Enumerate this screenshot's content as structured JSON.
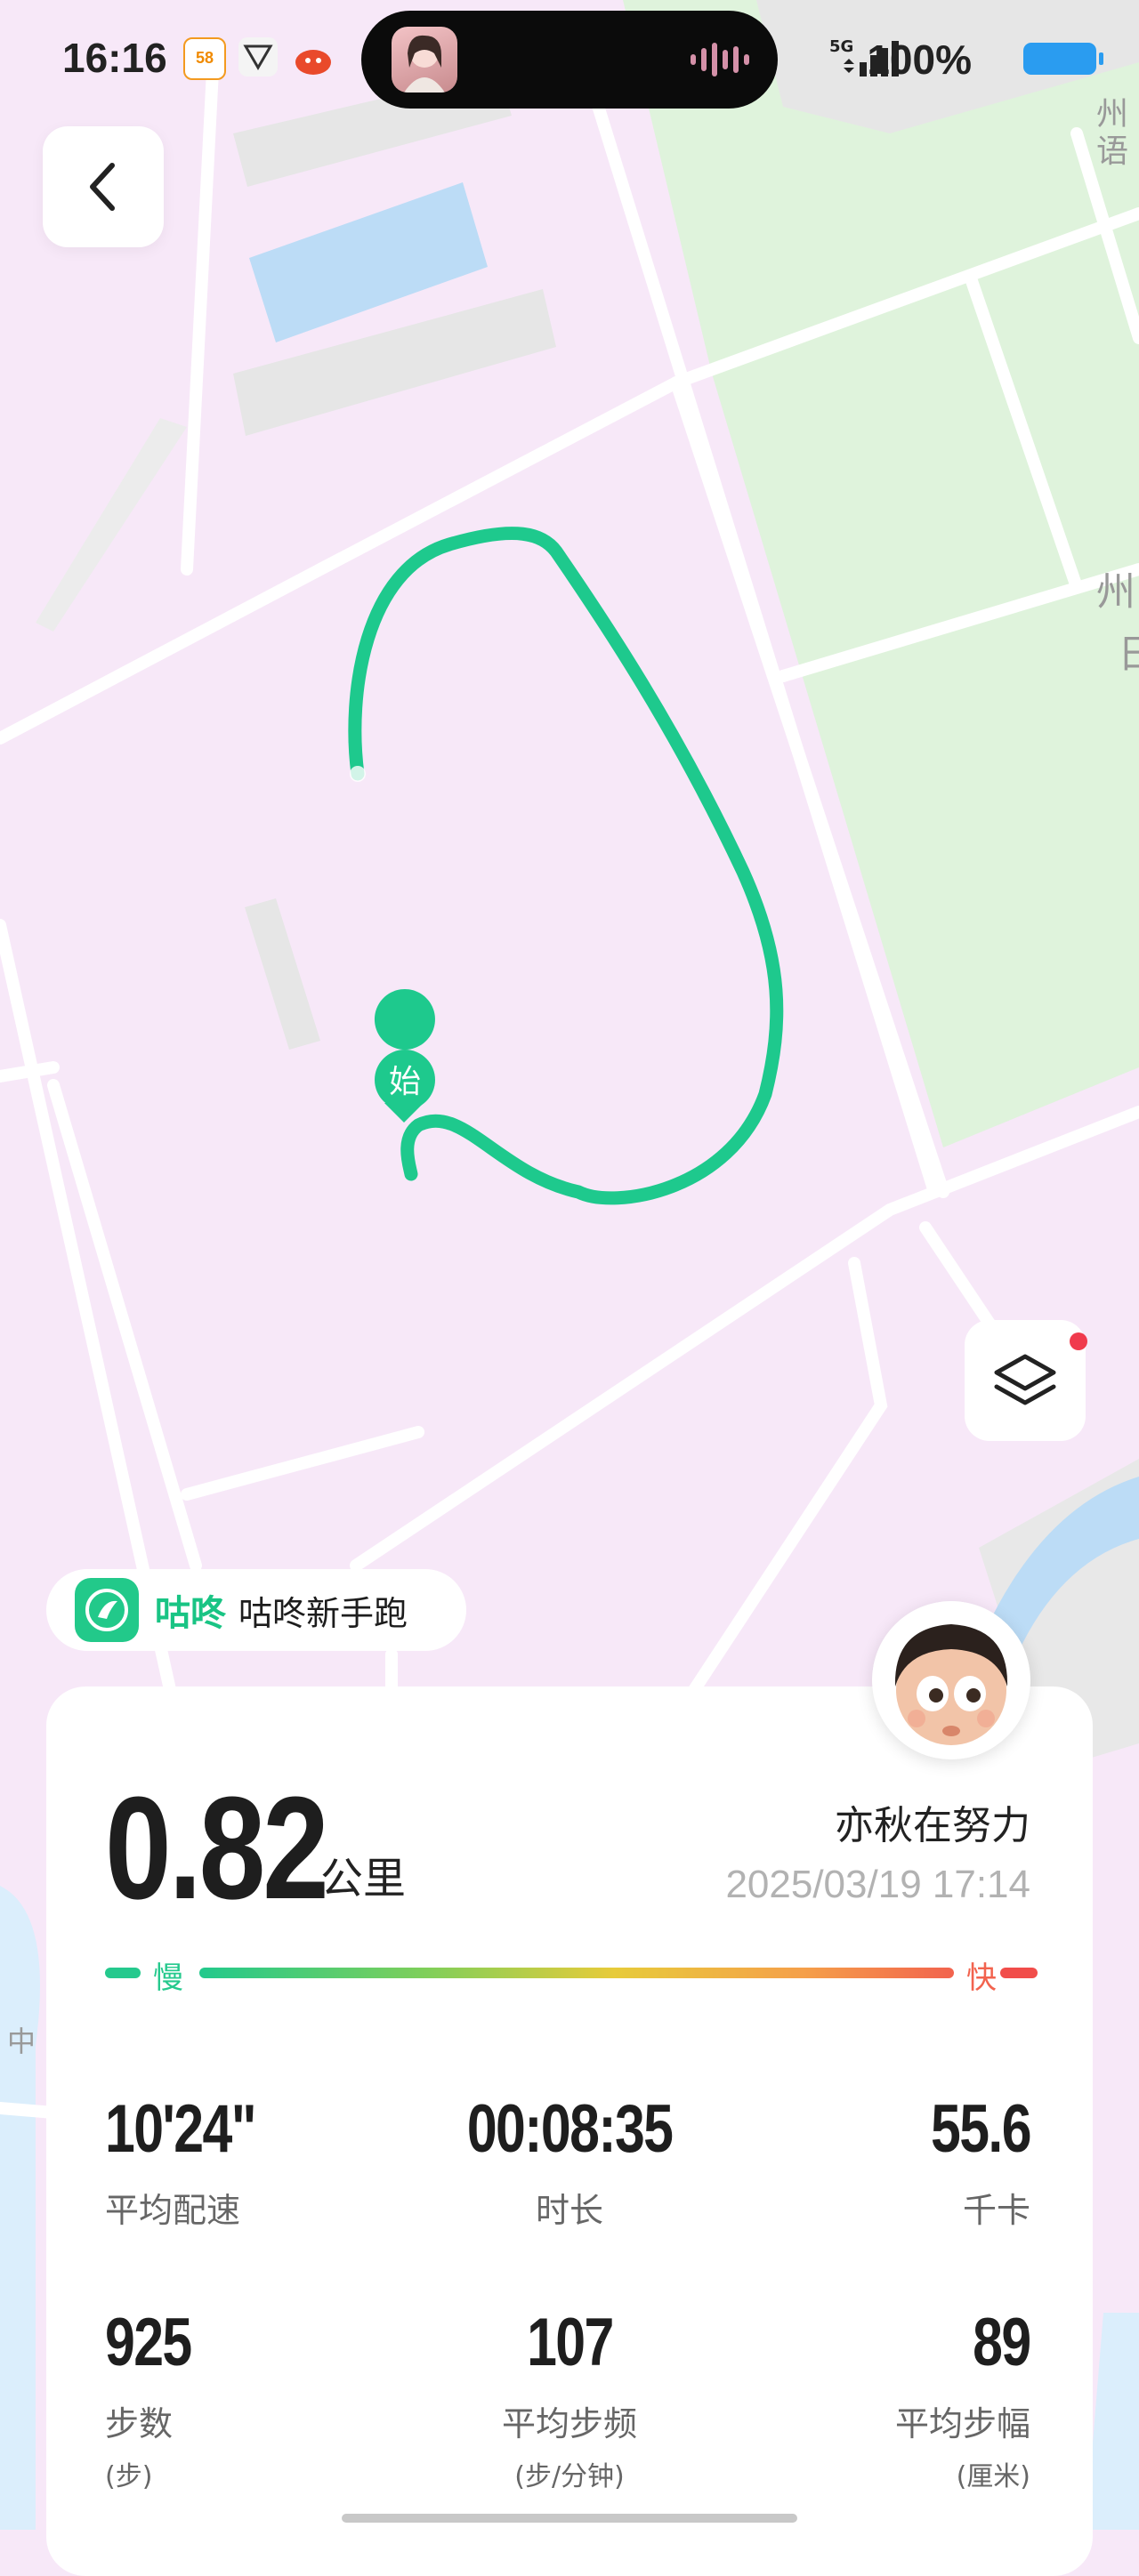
{
  "status_bar": {
    "time": "16:16",
    "network": "5G",
    "battery_percent": "100%",
    "notification_icons": [
      "58-app-icon",
      "game-app-icon",
      "red-app-icon"
    ]
  },
  "map": {
    "start_marker": "始",
    "map_labels": [
      "州",
      "语",
      "州",
      "日",
      "中"
    ]
  },
  "brand": {
    "logo_name": "咕咚",
    "tagline": "咕咚新手跑"
  },
  "summary": {
    "distance": "0.82",
    "distance_unit": "公里",
    "username": "亦秋在努力",
    "datetime": "2025/03/19 17:14"
  },
  "pace_legend": {
    "slow": "慢",
    "fast": "快",
    "colors": [
      "#22c98c",
      "#e7cb3a",
      "#f2634e"
    ]
  },
  "stats": [
    {
      "value": "10'24\"",
      "label": "平均配速",
      "unit": ""
    },
    {
      "value": "00:08:35",
      "label": "时长",
      "unit": ""
    },
    {
      "value": "55.6",
      "label": "千卡",
      "unit": ""
    },
    {
      "value": "925",
      "label": "步数",
      "unit": "(步)"
    },
    {
      "value": "107",
      "label": "平均步频",
      "unit": "(步/分钟)"
    },
    {
      "value": "89",
      "label": "平均步幅",
      "unit": "(厘米)"
    }
  ],
  "colors": {
    "route": "#1ec98d",
    "accent": "#19c484"
  }
}
